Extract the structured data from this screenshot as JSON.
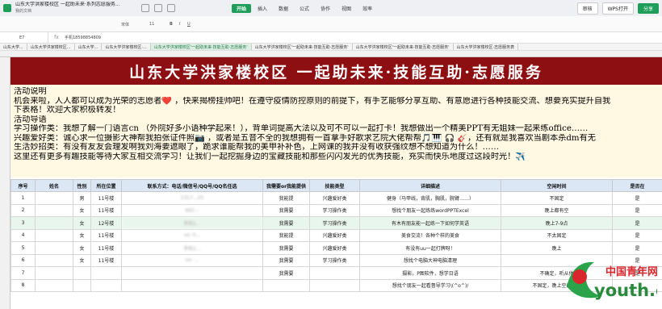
{
  "titlebar": {
    "doc_title": "山东大学洪家楼校区 一起助未来·系列志愿服务...",
    "doc_folder": "我的文档",
    "tabs": [
      "开始",
      "插入",
      "数据",
      "公式",
      "协作",
      "视图",
      "效率"
    ],
    "active_tab": "开始",
    "tools": [
      "审核",
      "WPS打开"
    ],
    "share_label": "分享"
  },
  "ribbon": {
    "font_name": "宋体",
    "font_size": "11"
  },
  "formula": {
    "cell_ref": "E7",
    "fx": "fx",
    "value": "手机18598854809"
  },
  "sheet_tabs": [
    "山东大学...",
    "山东大学洪家楼校区...",
    "山东大学...",
    "山东大学洪家楼校区·...",
    "山东大学洪家楼校区'一起助未来·技能互助·志愿服务'",
    "山东大学洪家楼校区'一起助未来·技能互助·志愿服务'",
    "山东大学洪家楼校区'一起助未来·技能互助·志愿服务'",
    "山东大学洪家楼校区·志愿服务表"
  ],
  "banner": "山东大学洪家楼校区 一起助未来·技能互助·志愿服务",
  "intro": {
    "heading1": "活动说明",
    "p1": "机会来啦，人人都可以成为光荣的志愿者❤️ ，快来揭榜挂帅吧！在遵守疫情防控原则的前提下，有手艺能够分享互助、有意愿进行各种技能交流、想要充实提升自我",
    "p2": "下表格！欢迎大家积极转发！",
    "heading2": "活动导语",
    "p3": "学习操作类：我想了解一门语言cn （外院好多小语种学起来！），背单词提高大法以及可不可以一起打卡！我想做出一个精美PPT有无姐妹一起来练office……",
    "p4": "兴趣爱好类：诚心求一位摄影大神帮我拍张证件照📷 ，或者是五音不全的我想拥有一首拿手好歌求艺院大佬帮帮🎵🎹 🎧 🎸，还有就是我喜欢当剧本杀dm有无",
    "p5": "生活妙招类：有没有友友会理发啊我刘海要遮眼了，跪求谁能帮我的美甲补补色，上网课的我并没有收获强纹想不想知道为什么！……",
    "p6": "这里还有更多有趣技能等待大家互相交流学习！让我们一起挖掘身边的宝藏技能和那些闪闪发光的优秀技能，充实而快乐地度过这段时光！✈️"
  },
  "table": {
    "headers": [
      "序号",
      "姓名",
      "性别",
      "所在位置",
      "联系方式：电话/微信号/QQ号/QQ名任选",
      "我需要or我能提供",
      "技能类型",
      "详细描述",
      "空闲时间",
      "是否在"
    ],
    "rows": [
      [
        "1",
        "",
        "男",
        "11号楼",
        "1317...25",
        "我能提",
        "兴趣爱好类",
        "健身（马甲线，背肌，胸肌，腕臂……）",
        "不固定",
        "是"
      ],
      [
        "2",
        "",
        "女",
        "11号楼",
        "qq1...",
        "我需要",
        "学习操作类",
        "想找个朋友一起练练wordPPTExcel",
        "晚上都有空",
        "是"
      ],
      [
        "3",
        "",
        "女",
        "12号楼",
        "手机1...",
        "我需要",
        "学习操作类",
        "有木有朋友能一起练一下如何学英语",
        "晚上7-9点",
        "是"
      ],
      [
        "4",
        "",
        "女",
        "11号楼",
        "vx: h...",
        "我能提",
        "兴趣爱好类",
        "美食交流！各种个样的美食",
        "不太固定",
        "是"
      ],
      [
        "5",
        "",
        "女",
        "11号楼",
        "手机1...",
        "我需要",
        "兴趣爱好类",
        "有没有uu一起打牌呀！",
        "晚上",
        "是"
      ],
      [
        "6",
        "",
        "女",
        "11号楼",
        "vx: ...",
        "我需要",
        "学习操作类",
        "想找个电脑大神电脑清理",
        "",
        "是"
      ],
      [
        "7",
        "",
        "",
        "",
        "",
        "我需要",
        "",
        "摄影，P图软件，想学日语",
        "不确定，听从他",
        "是"
      ],
      [
        "8",
        "",
        "",
        "",
        "",
        "",
        "",
        "想找个朋友一起看督导学习\\(^o^)/",
        "不固定，晚上空闲时间",
        ""
      ]
    ]
  },
  "watermark": {
    "text_cn": "中国青年网",
    "text_en": "youth.cn"
  },
  "colors": {
    "accent": "#1e9e5a",
    "banner_bg": "#8e0f12",
    "intro_bg": "#fff8e2",
    "header_bg": "#dbe7f5"
  }
}
